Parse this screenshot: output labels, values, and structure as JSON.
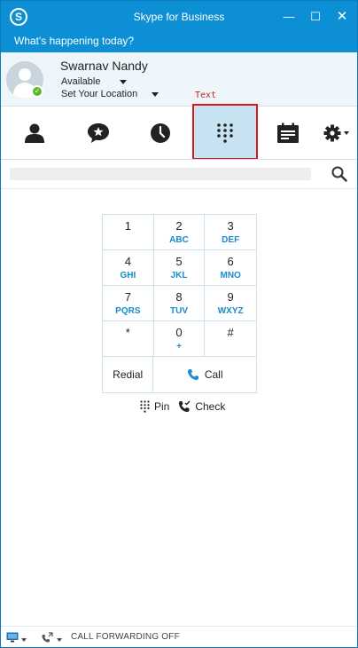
{
  "window": {
    "title": "Skype for Business",
    "logo_letter": "S",
    "min_glyph": "—",
    "max_glyph": "☐",
    "close_glyph": "✕"
  },
  "banner": {
    "text": "What's happening today?"
  },
  "profile": {
    "name": "Swarnav Nandy",
    "status": "Available",
    "location": "Set Your Location"
  },
  "annotation": {
    "label": "Text",
    "color": "#d21a1a"
  },
  "tabs": [
    {
      "name": "contacts",
      "icon": "person-icon"
    },
    {
      "name": "conversations",
      "icon": "chat-star-icon"
    },
    {
      "name": "recent",
      "icon": "clock-icon"
    },
    {
      "name": "dialpad",
      "icon": "dialpad-icon",
      "active": true
    },
    {
      "name": "meetings",
      "icon": "calendar-icon"
    },
    {
      "name": "options",
      "icon": "gear-icon"
    }
  ],
  "search": {
    "value": "",
    "placeholder": ""
  },
  "dialpad": {
    "keys": [
      {
        "digit": "1",
        "letters": ""
      },
      {
        "digit": "2",
        "letters": "ABC"
      },
      {
        "digit": "3",
        "letters": "DEF"
      },
      {
        "digit": "4",
        "letters": "GHI"
      },
      {
        "digit": "5",
        "letters": "JKL"
      },
      {
        "digit": "6",
        "letters": "MNO"
      },
      {
        "digit": "7",
        "letters": "PQRS"
      },
      {
        "digit": "8",
        "letters": "TUV"
      },
      {
        "digit": "9",
        "letters": "WXYZ"
      },
      {
        "digit": "*",
        "letters": ""
      },
      {
        "digit": "0",
        "letters": "+"
      },
      {
        "digit": "#",
        "letters": ""
      }
    ],
    "redial_label": "Redial",
    "call_label": "Call"
  },
  "extras": {
    "pin_label": "Pin",
    "check_label": "Check"
  },
  "footer": {
    "forwarding_text": "CALL FORWARDING OFF"
  },
  "colors": {
    "brand": "#0c8fd4",
    "accent_text": "#1a8ccc",
    "active_tab": "#c7e3f1",
    "presence": "#5cb82b"
  }
}
